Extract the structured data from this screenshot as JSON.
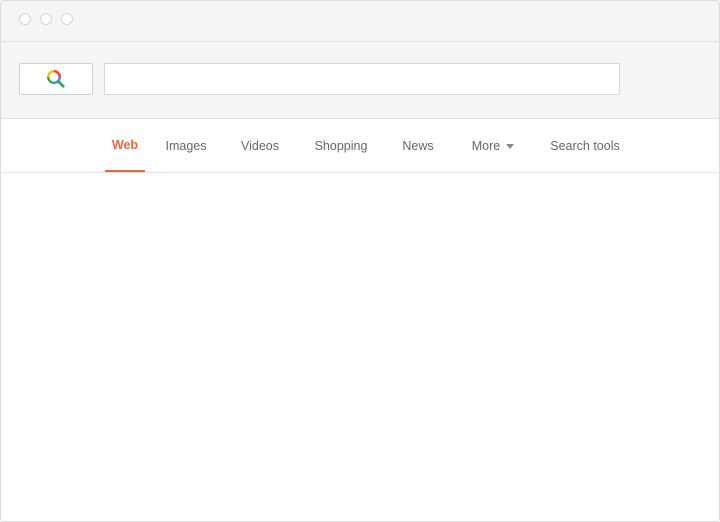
{
  "window": {
    "controls": [
      "close",
      "minimize",
      "maximize"
    ]
  },
  "search": {
    "logo_icon": "magnifier-logo-icon",
    "value": "",
    "placeholder": ""
  },
  "tabs": [
    {
      "label": "Web",
      "active": true
    },
    {
      "label": "Images",
      "active": false
    },
    {
      "label": "Videos",
      "active": false
    },
    {
      "label": "Shopping",
      "active": false
    },
    {
      "label": "News",
      "active": false
    },
    {
      "label": "More",
      "active": false,
      "icon": "chevron-down-icon"
    },
    {
      "label": "Search tools",
      "active": false
    }
  ],
  "colors": {
    "accent": "#e8683a",
    "chrome_bg": "#f5f5f5",
    "tab_text": "#666666",
    "logo_blue": "#4285f4",
    "logo_red": "#ea4335",
    "logo_yellow": "#fbbc05",
    "logo_green": "#34a853"
  }
}
